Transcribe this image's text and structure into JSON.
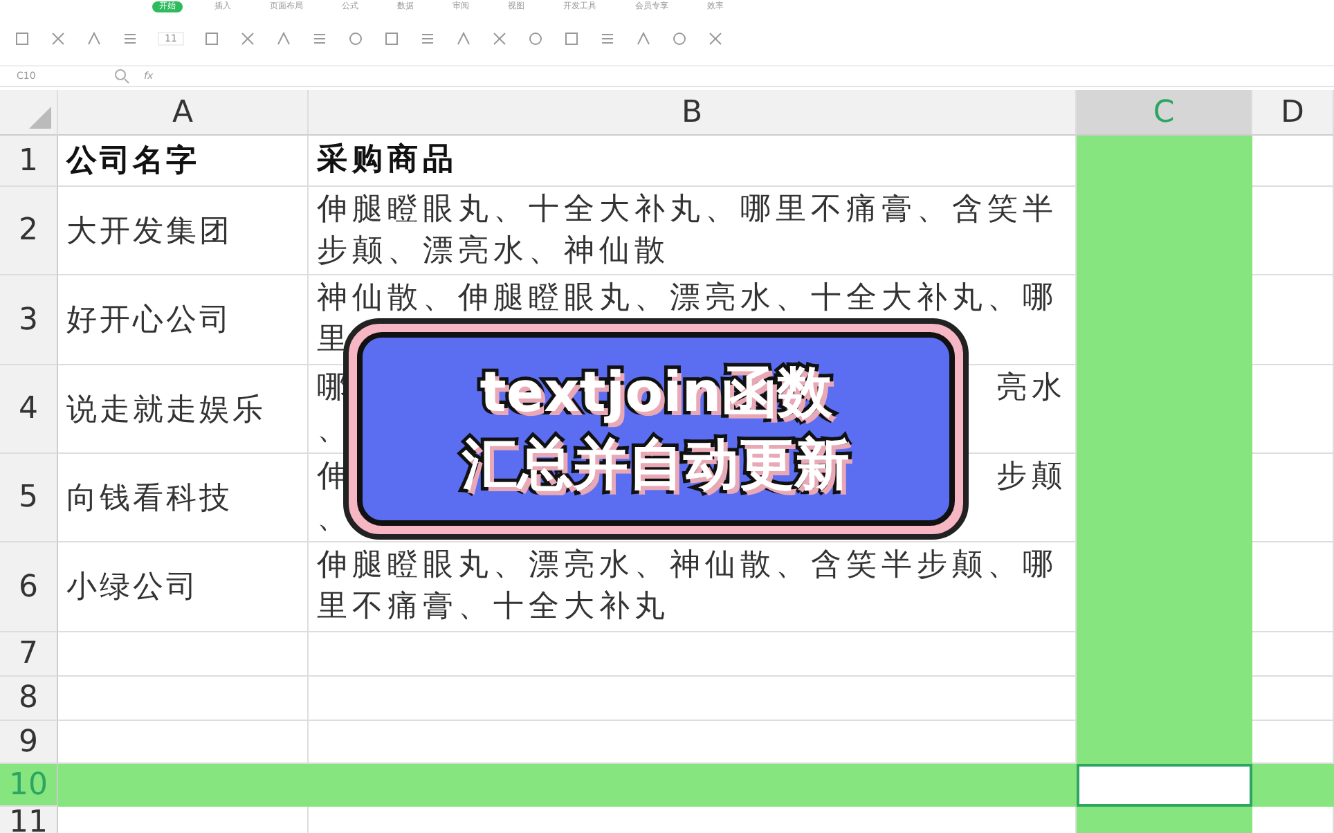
{
  "menu_tabs": [
    {
      "label": "开始",
      "selected": true
    },
    {
      "label": "插入",
      "selected": false
    },
    {
      "label": "页面布局",
      "selected": false
    },
    {
      "label": "公式",
      "selected": false
    },
    {
      "label": "数据",
      "selected": false
    },
    {
      "label": "审阅",
      "selected": false
    },
    {
      "label": "视图",
      "selected": false
    },
    {
      "label": "开发工具",
      "selected": false
    },
    {
      "label": "会员专享",
      "selected": false
    },
    {
      "label": "效率",
      "selected": false
    }
  ],
  "ribbon": {
    "font_size": "11"
  },
  "formula_bar": {
    "name_box": "C10",
    "fx": "fx"
  },
  "columns": [
    {
      "label": "A",
      "selected": false
    },
    {
      "label": "B",
      "selected": false
    },
    {
      "label": "C",
      "selected": true
    },
    {
      "label": "D",
      "selected": false
    }
  ],
  "rows": [
    {
      "number": "1",
      "selected": false,
      "a": "公司名字",
      "b": [
        {
          "left": "采购商品"
        }
      ],
      "kind": "header"
    },
    {
      "number": "2",
      "selected": false,
      "a": "大开发集团",
      "b": [
        {
          "left": "伸腿瞪眼丸、十全大补丸、哪里不痛膏、含笑半"
        },
        {
          "left": "步颠、漂亮水、神仙散"
        }
      ],
      "kind": "data"
    },
    {
      "number": "3",
      "selected": false,
      "a": "好开心公司",
      "b": [
        {
          "left": "神仙散、伸腿瞪眼丸、漂亮水、十全大补丸、哪"
        },
        {
          "left": "里"
        }
      ],
      "kind": "data"
    },
    {
      "number": "4",
      "selected": false,
      "a": "说走就走娱乐",
      "b": [
        {
          "left": "哪",
          "right": "亮水"
        },
        {
          "left": "、"
        }
      ],
      "kind": "data"
    },
    {
      "number": "5",
      "selected": false,
      "a": "向钱看科技",
      "b": [
        {
          "left": "伸",
          "right": "步颠"
        },
        {
          "left": "、"
        }
      ],
      "kind": "data"
    },
    {
      "number": "6",
      "selected": false,
      "a": "小绿公司",
      "b": [
        {
          "left": "伸腿瞪眼丸、漂亮水、神仙散、含笑半步颠、哪"
        },
        {
          "left": "里不痛膏、十全大补丸"
        }
      ],
      "kind": "data"
    },
    {
      "number": "7",
      "selected": false,
      "a": "",
      "b": [],
      "kind": "data"
    },
    {
      "number": "8",
      "selected": false,
      "a": "",
      "b": [],
      "kind": "data"
    },
    {
      "number": "9",
      "selected": false,
      "a": "",
      "b": [],
      "kind": "data"
    },
    {
      "number": "10",
      "selected": true,
      "a": "",
      "b": [],
      "kind": "data"
    },
    {
      "number": "11",
      "selected": false,
      "a": "",
      "b": [],
      "kind": "data"
    }
  ],
  "overlay": {
    "line_1": "textjoin函数",
    "line_2": "汇总并自动更新"
  }
}
